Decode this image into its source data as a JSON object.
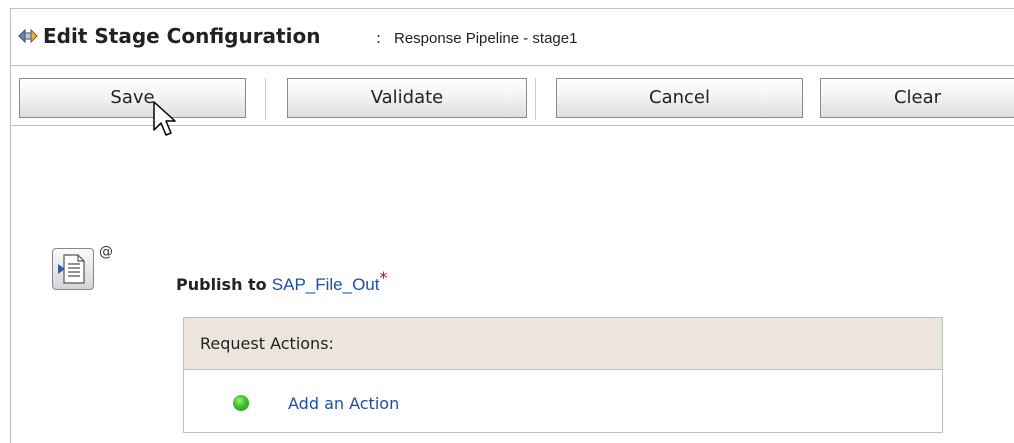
{
  "header": {
    "title": "Edit Stage Configuration",
    "separator": ":",
    "subtitle": "Response Pipeline - stage1",
    "icon": "stage-config-icon"
  },
  "toolbar": {
    "save_label": "Save",
    "validate_label": "Validate",
    "cancel_label": "Cancel",
    "clear_label": "Clear"
  },
  "publish": {
    "icon": "publish-action-icon",
    "at_symbol": "@",
    "prefix": "Publish to",
    "target": "SAP_File_Out",
    "required_marker": "*"
  },
  "request_actions": {
    "header": "Request Actions:",
    "add_action_label": "Add an Action",
    "add_icon": "green-dot-icon"
  },
  "colors": {
    "link": "#1a4fb0",
    "required": "#d80000",
    "panel_header_bg": "#ece5db",
    "border": "#b9c3cf"
  }
}
